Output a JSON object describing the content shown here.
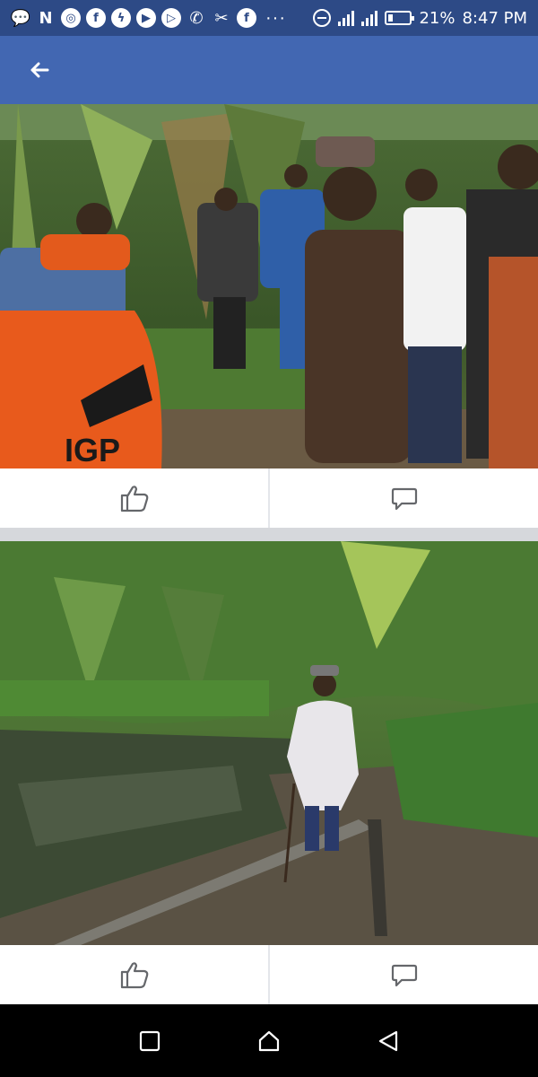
{
  "status_bar": {
    "left_icons": [
      {
        "name": "messaging-icon",
        "glyph": "💬"
      },
      {
        "name": "n-app-icon",
        "glyph": "N"
      },
      {
        "name": "chrome-icon",
        "glyph": "◎"
      },
      {
        "name": "facebook-icon",
        "glyph": "f"
      },
      {
        "name": "messenger-icon",
        "glyph": "ϟ"
      },
      {
        "name": "youtube-icon",
        "glyph": "▶"
      },
      {
        "name": "play-icon",
        "glyph": "▷"
      },
      {
        "name": "phone-icon",
        "glyph": "✆"
      },
      {
        "name": "tools-icon",
        "glyph": "✂"
      },
      {
        "name": "facebook-lite-icon",
        "glyph": "f"
      }
    ],
    "more": "···",
    "battery": "21%",
    "battery_level": 0.21,
    "time": "8:47 PM"
  },
  "app_bar": {
    "back_icon": "arrow-left-icon",
    "color": "#4267b2"
  },
  "posts": [
    {
      "photo_description_color": "#3b5a2a",
      "life_ring_text": "IGP",
      "actions": {
        "like_icon": "thumbs-up-icon",
        "comment_icon": "comment-icon"
      }
    },
    {
      "photo_description_color": "#456b34",
      "actions": {
        "like_icon": "thumbs-up-icon",
        "comment_icon": "comment-icon"
      }
    }
  ],
  "nav_bar": {
    "buttons": [
      "recent-apps-icon",
      "home-icon",
      "back-triangle-icon"
    ]
  },
  "colors": {
    "status_bar": "#2d4a86",
    "app_bar": "#4267b2",
    "divider": "#d6d8dc",
    "icon": "#65676b"
  }
}
